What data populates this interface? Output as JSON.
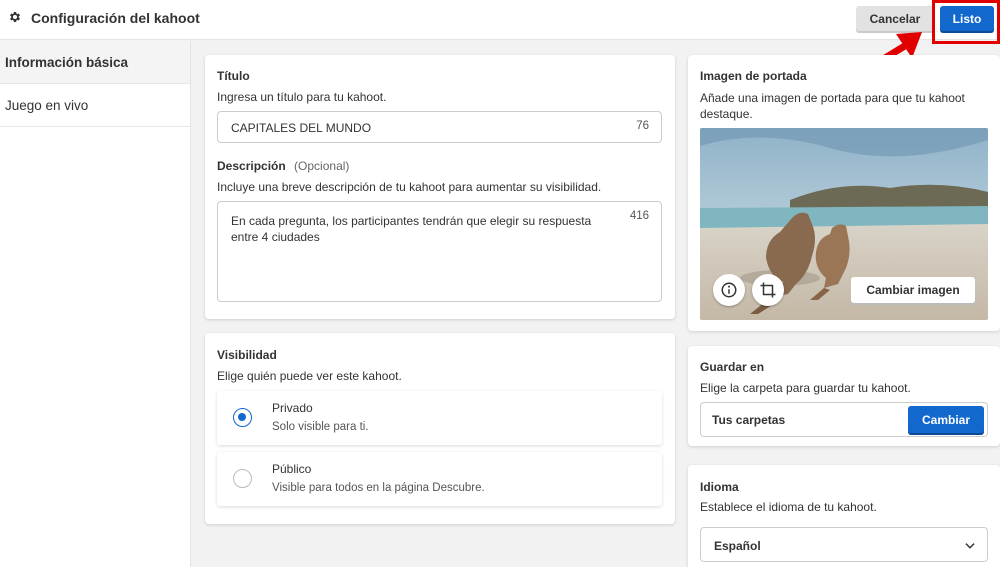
{
  "header": {
    "title": "Configuración del kahoot",
    "cancel_label": "Cancelar",
    "done_label": "Listo"
  },
  "sidebar": {
    "items": [
      {
        "label": "Información básica",
        "active": true
      },
      {
        "label": "Juego en vivo",
        "active": false
      }
    ]
  },
  "title_section": {
    "label": "Título",
    "hint": "Ingresa un título para tu kahoot.",
    "value": "CAPITALES DEL MUNDO",
    "remaining": "76"
  },
  "description_section": {
    "label": "Descripción",
    "optional": "(Opcional)",
    "hint": "Incluye una breve descripción de tu kahoot para aumentar su visibilidad.",
    "value": "En cada pregunta, los participantes tendrán que elegir su respuesta entre 4 ciudades",
    "remaining": "416"
  },
  "visibility": {
    "label": "Visibilidad",
    "hint": "Elige quién puede ver este kahoot.",
    "options": [
      {
        "title": "Privado",
        "desc": "Solo visible para ti.",
        "selected": true
      },
      {
        "title": "Público",
        "desc": "Visible para todos en la página Descubre.",
        "selected": false
      }
    ]
  },
  "cover_image": {
    "label": "Imagen de portada",
    "hint": "Añade una imagen de portada para que tu kahoot destaque.",
    "change_label": "Cambiar imagen",
    "icons": [
      "info-icon",
      "crop-icon"
    ]
  },
  "save_in": {
    "label": "Guardar en",
    "hint": "Elige la carpeta para guardar tu kahoot.",
    "folder": "Tus carpetas",
    "change_label": "Cambiar"
  },
  "language": {
    "label": "Idioma",
    "hint": "Establece el idioma de tu kahoot.",
    "value": "Español"
  },
  "colors": {
    "accent": "#1368ce",
    "highlight": "#e00000"
  }
}
